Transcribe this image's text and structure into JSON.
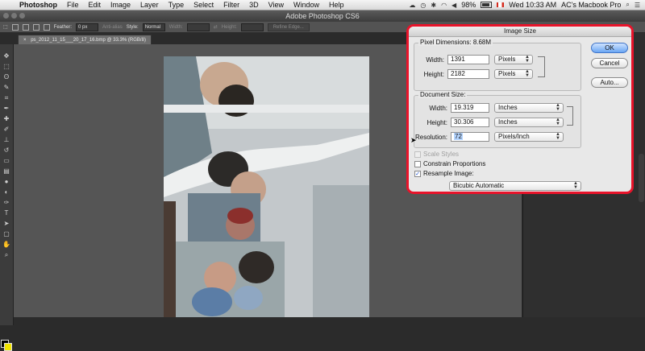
{
  "menubar": {
    "apple_icon": "apple-icon",
    "items": [
      "Photoshop",
      "File",
      "Edit",
      "Image",
      "Layer",
      "Type",
      "Select",
      "Filter",
      "3D",
      "View",
      "Window",
      "Help"
    ],
    "status": {
      "battery": "98%",
      "clock": "Wed 10:33 AM",
      "user": "AC's Macbook Pro"
    }
  },
  "window": {
    "title": "Adobe Photoshop CS6"
  },
  "options_bar": {
    "feather_label": "Feather:",
    "feather_value": "0 px",
    "anti_alias_label": "Anti-alias",
    "style_label": "Style:",
    "style_value": "Normal",
    "width_label": "Width:",
    "height_label": "Height:",
    "refine_edge": "Refine Edge..."
  },
  "document_tab": {
    "title": "ps_2012_11_15___20_17_16.bmp @ 33.3% (RGB/8)"
  },
  "dialog": {
    "title": "Image Size",
    "pixel_dimensions": {
      "title": "Pixel Dimensions:",
      "size": "8.68M",
      "width_label": "Width:",
      "width_value": "1391",
      "width_unit": "Pixels",
      "height_label": "Height:",
      "height_value": "2182",
      "height_unit": "Pixels"
    },
    "document_size": {
      "title": "Document Size:",
      "width_label": "Width:",
      "width_value": "19.319",
      "width_unit": "Inches",
      "height_label": "Height:",
      "height_value": "30.306",
      "height_unit": "Inches",
      "resolution_label": "Resolution:",
      "resolution_value": "72",
      "resolution_unit": "Pixels/Inch"
    },
    "scale_styles": "Scale Styles",
    "constrain_proportions": "Constrain Proportions",
    "resample_image": "Resample Image:",
    "resample_method": "Bicubic Automatic",
    "buttons": {
      "ok": "OK",
      "cancel": "Cancel",
      "auto": "Auto..."
    }
  },
  "colors": {
    "highlight_border": "#e8132a",
    "foreground": "#000000",
    "background": "#f1e400"
  }
}
